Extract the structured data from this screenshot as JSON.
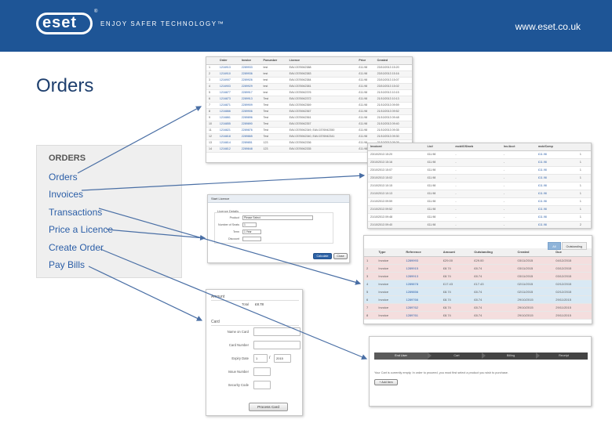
{
  "brand": {
    "logo": "eset",
    "trademark": "®",
    "tagline": "ENJOY SAFER TECHNOLOGY™",
    "url": "www.eset.co.uk"
  },
  "slide": {
    "title": "Orders"
  },
  "menu": {
    "heading": "ORDERS",
    "items": [
      "Orders",
      "Invoices",
      "Transactions",
      "Price a Licence",
      "Create Order",
      "Pay Bills"
    ]
  },
  "orders_table": {
    "headers": [
      "",
      "Order",
      "Invoice",
      "Ponumber",
      "Licence",
      "Price",
      "Created"
    ],
    "rows": [
      [
        "1",
        "1216913",
        "2289933",
        "test",
        "EAV-0376942388",
        "£11.98",
        "23/10/2013 15:20"
      ],
      [
        "2",
        "1216910",
        "2289936",
        "test",
        "EAV-0376942383",
        "£11.98",
        "23/10/2013 15:16"
      ],
      [
        "3",
        "1216907",
        "2289926",
        "test",
        "EAV-0376942384",
        "£11.98",
        "23/10/2013 15:07"
      ],
      [
        "4",
        "1216903",
        "2289929",
        "test",
        "EAV-0376942381",
        "£11.98",
        "23/10/2013 15:02"
      ],
      [
        "5",
        "1216877",
        "2289917",
        "test",
        "EAV-0376942376",
        "£11.98",
        "21/10/2013 10:15"
      ],
      [
        "6",
        "1216873",
        "2289913",
        "Test",
        "EAV-0376942372",
        "£11.98",
        "21/10/2013 10:13"
      ],
      [
        "7",
        "1216871",
        "2289909",
        "Test",
        "EAV-0376942369",
        "£11.98",
        "21/10/2013 09:59"
      ],
      [
        "8",
        "1216866",
        "2289906",
        "Test",
        "EAV-0376942367",
        "£11.98",
        "21/10/2013 09:52"
      ],
      [
        "9",
        "1216861",
        "2289896",
        "Test",
        "EAV-0376942361",
        "£11.98",
        "21/10/2013 09:48"
      ],
      [
        "10",
        "1216855",
        "2289890",
        "Test",
        "EAV-0376942357",
        "£11.98",
        "21/10/2013 09:40"
      ],
      [
        "11",
        "1216821",
        "2289876",
        "Test",
        "EAV-0376942349, EAV-0376942350",
        "£11.98",
        "21/10/2013 09:35"
      ],
      [
        "12",
        "1216818",
        "2289865",
        "Test",
        "EAV-0376942340, EAV-0376942341",
        "£11.98",
        "21/10/2013 09:30"
      ],
      [
        "13",
        "1216814",
        "2289851",
        "123",
        "EAV-0376942336",
        "£11.98",
        "21/10/2013 09:26"
      ],
      [
        "14",
        "1216812",
        "2289848",
        "123",
        "EAV-0376942335",
        "£11.98",
        "21/10/2013 09:20"
      ]
    ]
  },
  "invoices_table": {
    "headers": [
      "Invoiced",
      "Lic#",
      "mob/iOS/web",
      "Inv./Acct",
      "mob/Comp"
    ],
    "rows": [
      [
        "23/10/2013 15:20",
        "£11.98",
        "-",
        "-",
        "£11.98",
        "1"
      ],
      [
        "23/10/2013 15:16",
        "£11.98",
        "-",
        "-",
        "£11.98",
        "1"
      ],
      [
        "23/10/2013 15:07",
        "£11.98",
        "-",
        "-",
        "£11.98",
        "1"
      ],
      [
        "23/10/2013 15:02",
        "£11.98",
        "-",
        "-",
        "£11.98",
        "1"
      ],
      [
        "21/10/2013 10:15",
        "£11.98",
        "-",
        "-",
        "£11.98",
        "1"
      ],
      [
        "21/10/2013 10:13",
        "£11.98",
        "-",
        "-",
        "£11.98",
        "1"
      ],
      [
        "21/10/2013 09:59",
        "£11.98",
        "-",
        "-",
        "£11.98",
        "1"
      ],
      [
        "21/10/2013 09:52",
        "£11.98",
        "-",
        "-",
        "£11.98",
        "1"
      ],
      [
        "21/10/2013 09:48",
        "£11.98",
        "-",
        "-",
        "£11.98",
        "1"
      ],
      [
        "21/10/2013 09:40",
        "£11.98",
        "-",
        "-",
        "£11.98",
        "2"
      ],
      [
        "21/10/2013 09:35",
        "£11.98",
        "-",
        "-",
        "£11.98",
        "2"
      ],
      [
        "21/10/2013 09:30",
        "£11.98",
        "-",
        "-",
        "£11.98",
        "1"
      ]
    ]
  },
  "licence_form": {
    "panel_title": "Start Licence",
    "group_title": "Licence Details",
    "fields": [
      {
        "label": "Product",
        "value": "Please Select"
      },
      {
        "label": "Number of Seats",
        "value": "1"
      },
      {
        "label": "Term",
        "value": "1 Year"
      },
      {
        "label": "Discount",
        "value": ""
      }
    ],
    "calc_button": "Calculate",
    "close_button": "Close"
  },
  "transactions_table": {
    "tabs": [
      "All",
      "Outstanding"
    ],
    "headers": [
      "",
      "Type",
      "Reference",
      "Amount",
      "Outstanding",
      "Created",
      "Due"
    ],
    "rows": [
      {
        "style": "pink",
        "cells": [
          "1",
          "Invoice",
          "1289993",
          "£29.00",
          "£29.00",
          "03/11/2015",
          "04/12/2015"
        ]
      },
      {
        "style": "pink",
        "cells": [
          "2",
          "Invoice",
          "1289915",
          "£8.74",
          "£8.74",
          "03/11/2015",
          "03/12/2015"
        ]
      },
      {
        "style": "pink",
        "cells": [
          "3",
          "Invoice",
          "1289913",
          "£8.74",
          "£8.74",
          "03/11/2015",
          "03/12/2015"
        ]
      },
      {
        "style": "blue",
        "cells": [
          "4",
          "Invoice",
          "1289878",
          "£17.43",
          "£17.43",
          "02/11/2015",
          "02/12/2015"
        ]
      },
      {
        "style": "blue",
        "cells": [
          "5",
          "Invoice",
          "1289856",
          "£8.74",
          "£8.74",
          "02/11/2015",
          "02/12/2015"
        ]
      },
      {
        "style": "blue",
        "cells": [
          "6",
          "Invoice",
          "1289766",
          "£8.74",
          "£8.74",
          "29/10/2015",
          "29/11/2015"
        ]
      },
      {
        "style": "pink",
        "cells": [
          "7",
          "Invoice",
          "1289762",
          "£8.74",
          "£8.74",
          "29/10/2015",
          "29/11/2015"
        ]
      },
      {
        "style": "pink",
        "cells": [
          "8",
          "Invoice",
          "1289761",
          "£8.74",
          "£8.74",
          "29/10/2015",
          "29/11/2015"
        ]
      }
    ]
  },
  "pay_bills": {
    "amount_section": "Amount",
    "total_label": "Total",
    "total_value": "£8.78",
    "card_section": "Card",
    "name_label": "Name on Card",
    "number_label": "Card Number",
    "expiry_label": "Expiry Date",
    "expiry_month": "1",
    "expiry_separator": "/",
    "expiry_year": "2015",
    "issue_label": "Issue Number",
    "security_label": "Security Code",
    "submit_button": "Process Card"
  },
  "create_order": {
    "steps": [
      "End User",
      "Cart",
      "Billing",
      "Receipt"
    ],
    "message": "Your Cart is currently empty. In order to proceed, you must first select a product you wish to purchase.",
    "add_button": "Add Item"
  }
}
